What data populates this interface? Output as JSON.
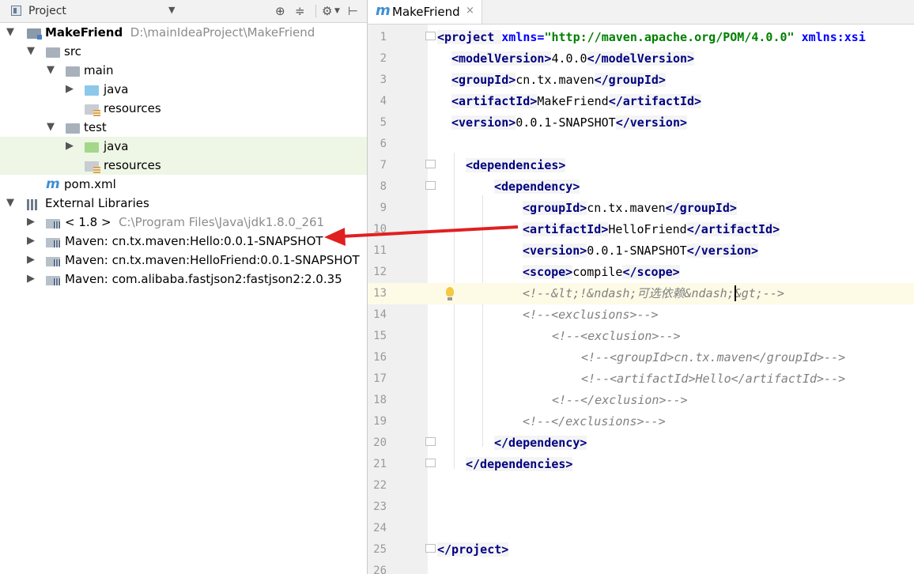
{
  "project_panel": {
    "title": "Project",
    "dropdown_glyph": "▼",
    "tree": [
      {
        "id": "makefriend",
        "label": "MakeFriend",
        "path": "D:\\mainIdeaProject\\MakeFriend"
      },
      {
        "id": "src",
        "label": "src"
      },
      {
        "id": "main",
        "label": "main"
      },
      {
        "id": "main-java",
        "label": "java"
      },
      {
        "id": "main-resources",
        "label": "resources"
      },
      {
        "id": "test",
        "label": "test"
      },
      {
        "id": "test-java",
        "label": "java"
      },
      {
        "id": "test-resources",
        "label": "resources"
      },
      {
        "id": "pom",
        "label": "pom.xml"
      },
      {
        "id": "ext-libs",
        "label": "External Libraries"
      },
      {
        "id": "jdk",
        "label": "< 1.8 >",
        "path": "C:\\Program Files\\Java\\jdk1.8.0_261"
      },
      {
        "id": "mvn-hello",
        "label": "Maven: cn.tx.maven:Hello:0.0.1-SNAPSHOT"
      },
      {
        "id": "mvn-hellofriend",
        "label": "Maven: cn.tx.maven:HelloFriend:0.0.1-SNAPSHOT"
      },
      {
        "id": "mvn-fastjson",
        "label": "Maven: com.alibaba.fastjson2:fastjson2:2.0.35"
      }
    ]
  },
  "editor": {
    "tab_label": "MakeFriend",
    "tab_icon": "m",
    "close_glyph": "×",
    "current_line": 13,
    "line_numbers": [
      "1",
      "2",
      "3",
      "4",
      "5",
      "6",
      "7",
      "8",
      "9",
      "10",
      "11",
      "12",
      "13",
      "14",
      "15",
      "16",
      "17",
      "18",
      "19",
      "20",
      "21",
      "22",
      "23",
      "24",
      "25",
      "26"
    ],
    "lines": {
      "l1": {
        "open": "<project ",
        "attr1": "xmlns=",
        "str1": "\"http://maven.apache.org/POM/4.0.0\"",
        "attr2": " xmlns:xsi"
      },
      "l2": {
        "o": "<modelVersion>",
        "t": "4.0.0",
        "c": "</modelVersion>"
      },
      "l3": {
        "o": "<groupId>",
        "t": "cn.tx.maven",
        "c": "</groupId>"
      },
      "l4": {
        "o": "<artifactId>",
        "t": "MakeFriend",
        "c": "</artifactId>"
      },
      "l5": {
        "o": "<version>",
        "t": "0.0.1-SNAPSHOT",
        "c": "</version>"
      },
      "l7": {
        "o": "<dependencies>"
      },
      "l8": {
        "o": "<dependency>"
      },
      "l9": {
        "o": "<groupId>",
        "t": "cn.tx.maven",
        "c": "</groupId>"
      },
      "l10": {
        "o": "<artifactId>",
        "t": "HelloFriend",
        "c": "</artifactId>"
      },
      "l11": {
        "o": "<version>",
        "t": "0.0.1-SNAPSHOT",
        "c": "</version>"
      },
      "l12": {
        "o": "<scope>",
        "t": "compile",
        "c": "</scope>"
      },
      "l13": {
        "cmt": "<!--&lt;!&ndash;可选依赖&ndash;&gt;-->"
      },
      "l14": {
        "cmt": "<!--<exclusions>-->"
      },
      "l15": {
        "cmt": "<!--<exclusion>-->"
      },
      "l16": {
        "cmt": "<!--<groupId>cn.tx.maven</groupId>-->"
      },
      "l17": {
        "cmt": "<!--<artifactId>Hello</artifactId>-->"
      },
      "l18": {
        "cmt": "<!--</exclusion>-->"
      },
      "l19": {
        "cmt": "<!--</exclusions>-->"
      },
      "l20": {
        "c": "</dependency>"
      },
      "l21": {
        "c": "</dependencies>"
      },
      "l25": {
        "c": "</project>"
      }
    }
  },
  "colors": {
    "annotation_arrow": "#e02020",
    "tag": "#000080",
    "string": "#008000",
    "comment": "#808080",
    "current_line_bg": "#fdfbe6",
    "selected_row_bg": "#eef6e5"
  }
}
